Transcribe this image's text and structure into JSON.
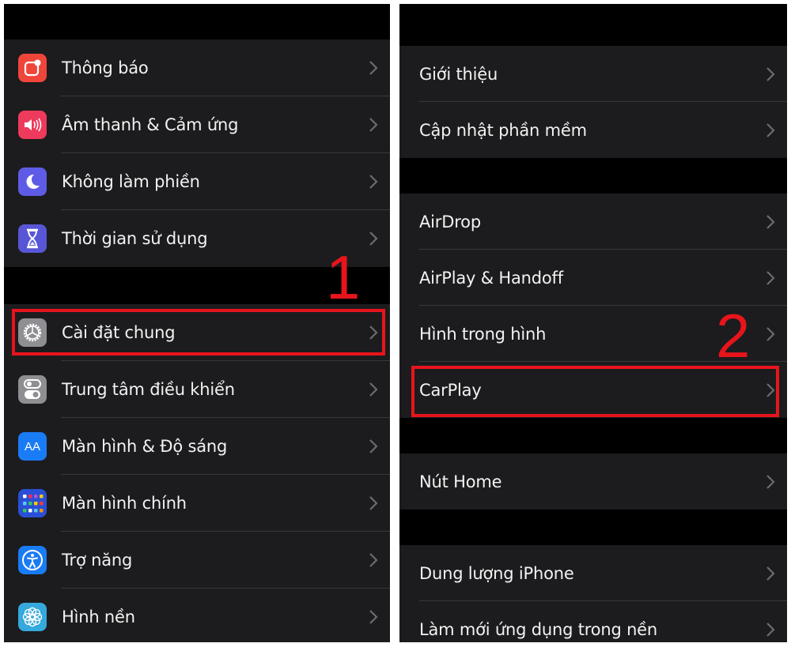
{
  "left_panel": {
    "groups": [
      {
        "items": [
          {
            "label": "Thông báo",
            "icon": "notifications-icon",
            "color": "#f0453a"
          },
          {
            "label": "Âm thanh & Cảm ứng",
            "icon": "sound-icon",
            "color": "#ee3a5c"
          },
          {
            "label": "Không làm phiền",
            "icon": "moon-icon",
            "color": "#5e5ce6"
          },
          {
            "label": "Thời gian sử dụng",
            "icon": "hourglass-icon",
            "color": "#5856d6"
          }
        ]
      },
      {
        "items": [
          {
            "label": "Cài đặt chung",
            "icon": "gear-icon",
            "color": "#8e8e93"
          },
          {
            "label": "Trung tâm điều khiển",
            "icon": "toggles-icon",
            "color": "#8e8e93"
          },
          {
            "label": "Màn hình & Độ sáng",
            "icon": "text-size-icon",
            "color": "#1a7cf5",
            "glyph": "AA"
          },
          {
            "label": "Màn hình chính",
            "icon": "home-screen-grid-icon",
            "color": "#2a4fd6"
          },
          {
            "label": "Trợ năng",
            "icon": "accessibility-icon",
            "color": "#1a7cf5"
          },
          {
            "label": "Hình nền",
            "icon": "wallpaper-flower-icon",
            "color": "#35a9dc"
          }
        ]
      }
    ]
  },
  "right_panel": {
    "groups": [
      {
        "items": [
          {
            "label": "Giới thiệu"
          },
          {
            "label": "Cập nhật phần mềm"
          }
        ]
      },
      {
        "items": [
          {
            "label": "AirDrop"
          },
          {
            "label": "AirPlay & Handoff"
          },
          {
            "label": "Hình trong hình"
          },
          {
            "label": "CarPlay"
          }
        ]
      },
      {
        "items": [
          {
            "label": "Nút Home"
          }
        ]
      },
      {
        "items": [
          {
            "label": "Dung lượng iPhone"
          },
          {
            "label": "Làm mới ứng dụng trong nền"
          }
        ]
      }
    ]
  },
  "annotations": {
    "step1": "1",
    "step2": "2",
    "highlight_color": "#e8141c"
  }
}
